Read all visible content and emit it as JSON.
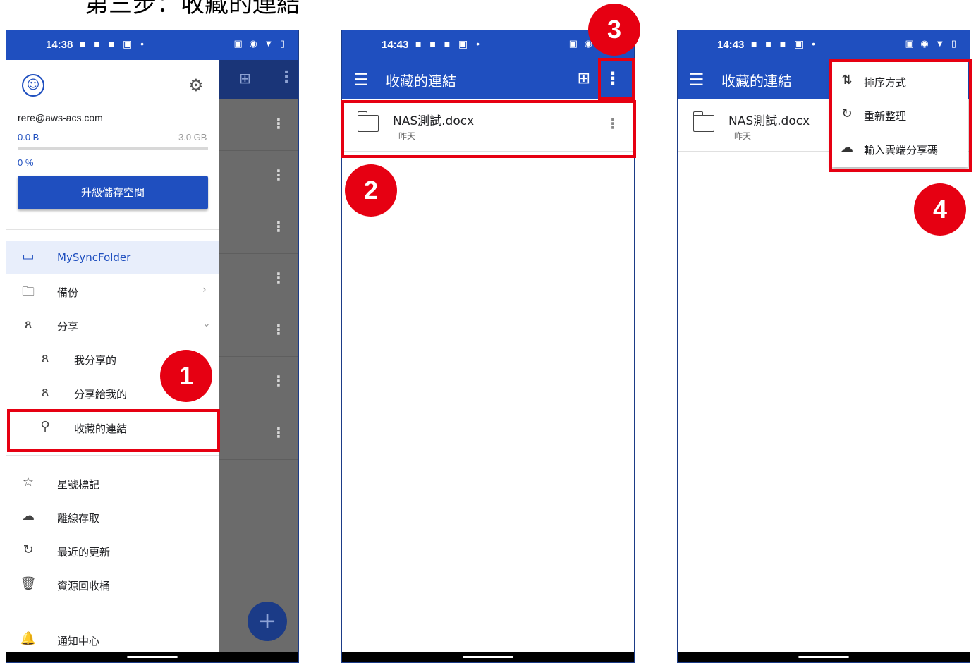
{
  "heading": "第三步：收藏的連結",
  "colors": {
    "primary": "#1f4fbf",
    "highlight": "#e60012",
    "dim": "#6b6b6b"
  },
  "steps": [
    "1",
    "2",
    "3",
    "4"
  ],
  "phone1": {
    "status": {
      "time": "14:38",
      "notif_icons": "■ ■ ■ ▣ •",
      "system_icons": "▣ ◉ ▼ ▯"
    },
    "account": {
      "avatar_icon": "user-circle-icon",
      "email": "rere@aws-acs.com",
      "used": "0.0 B",
      "total": "3.0 GB",
      "percent": "0 %",
      "usage_fraction": 0.0,
      "upgrade_label": "升級儲存空間"
    },
    "nav": {
      "mysync": "MySyncFolder",
      "backup": "備份",
      "share": "分享",
      "my_shares": "我分享的",
      "shared_with_me": "分享給我的",
      "favorite_links": "收藏的連結",
      "starred": "星號標記",
      "offline": "離線存取",
      "recent": "最近的更新",
      "trash": "資源回收桶",
      "notifications": "通知中心"
    }
  },
  "phone2": {
    "status": {
      "time": "14:43",
      "notif_icons": "■ ■ ■ ▣ •",
      "system_icons": "▣ ◉"
    },
    "title": "收藏的連結",
    "file": {
      "name": "NAS測試.docx",
      "date": "昨天"
    }
  },
  "phone3": {
    "status": {
      "time": "14:43",
      "notif_icons": "■ ■ ■ ▣ •",
      "system_icons": "▣ ◉ ▼ ▯"
    },
    "title": "收藏的連結",
    "file": {
      "name": "NAS測試.docx",
      "date": "昨天"
    },
    "menu": {
      "sort": "排序方式",
      "refresh": "重新整理",
      "enter_code": "輸入雲端分享碼"
    }
  }
}
